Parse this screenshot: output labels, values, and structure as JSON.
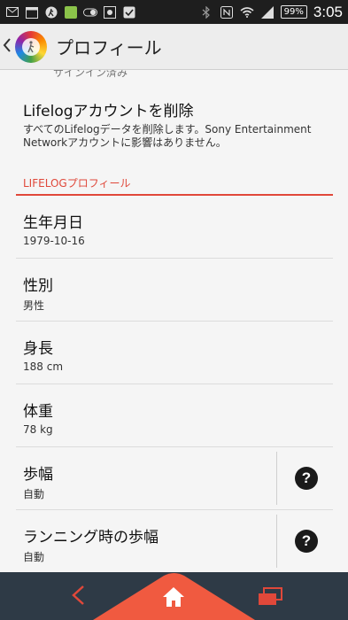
{
  "status_bar": {
    "icons": [
      "gmail-icon",
      "calendar-icon",
      "walk-icon",
      "app-icon",
      "toggle-icon",
      "camera-icon",
      "check-icon"
    ],
    "right_icons": [
      "bluetooth-icon",
      "nfc-icon",
      "wifi-icon",
      "signal-icon"
    ],
    "battery": "99%",
    "time": "3:05"
  },
  "action_bar": {
    "title": "プロフィール"
  },
  "content": {
    "partial_text": "サインイン済み",
    "delete": {
      "title": "Lifelogアカウントを削除",
      "description": "すべてのLifelogデータを削除します。Sony Entertainment Networkアカウントに影響はありません。"
    },
    "section_header": "LIFELOGプロフィール",
    "rows": [
      {
        "label": "生年月日",
        "value": "1979-10-16"
      },
      {
        "label": "性別",
        "value": "男性"
      },
      {
        "label": "身長",
        "value": "188 cm"
      },
      {
        "label": "体重",
        "value": "78 kg"
      },
      {
        "label": "歩幅",
        "value": "自動"
      },
      {
        "label": "ランニング時の歩幅",
        "value": "自動"
      }
    ],
    "help_glyph": "?"
  },
  "colors": {
    "accent": "#e0483a",
    "nav_bar": "#2e3a46",
    "home_orange": "#f05a40"
  }
}
